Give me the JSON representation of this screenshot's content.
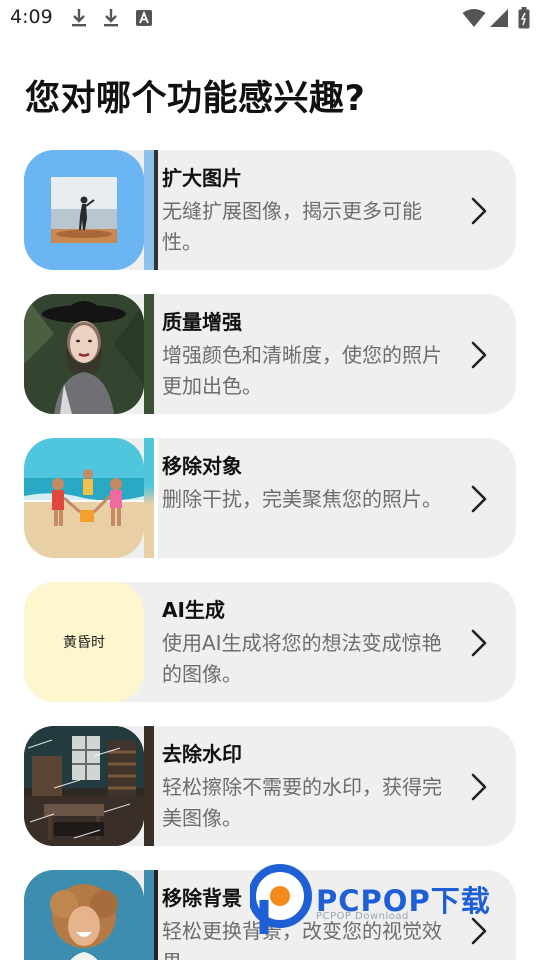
{
  "status_bar": {
    "time": "4:09",
    "left_icons": [
      "download-icon",
      "download-icon",
      "font-a-icon"
    ],
    "right_icons": [
      "wifi-icon",
      "signal-icon",
      "battery-icon"
    ]
  },
  "title": "您对哪个功能感兴趣?",
  "features": [
    {
      "title": "扩大图片",
      "description": "无缝扩展图像，揭示更多可能性。",
      "icon": "chevron-right-icon"
    },
    {
      "title": "质量增强",
      "description": "增强颜色和清晰度，使您的照片更加出色。",
      "icon": "chevron-right-icon"
    },
    {
      "title": "移除对象",
      "description": "删除干扰，完美聚焦您的照片。",
      "icon": "chevron-right-icon"
    },
    {
      "title": "AI生成",
      "description": "使用AI生成将您的想法变成惊艳的图像。",
      "icon": "chevron-right-icon",
      "thumb_text": "黄昏时"
    },
    {
      "title": "去除水印",
      "description": "轻松擦除不需要的水印，获得完美图像。",
      "icon": "chevron-right-icon"
    },
    {
      "title": "移除背景",
      "description": "轻松更换背景，改变您的视觉效果。",
      "icon": "chevron-right-icon"
    }
  ],
  "watermark": {
    "brand": "PCPOP下载",
    "sub": "PCPOP Download"
  },
  "colors": {
    "card_bg": "#efefef",
    "title_text": "#111111",
    "desc_text": "#6d6d6d",
    "watermark_blue": "#1f5fd6"
  }
}
